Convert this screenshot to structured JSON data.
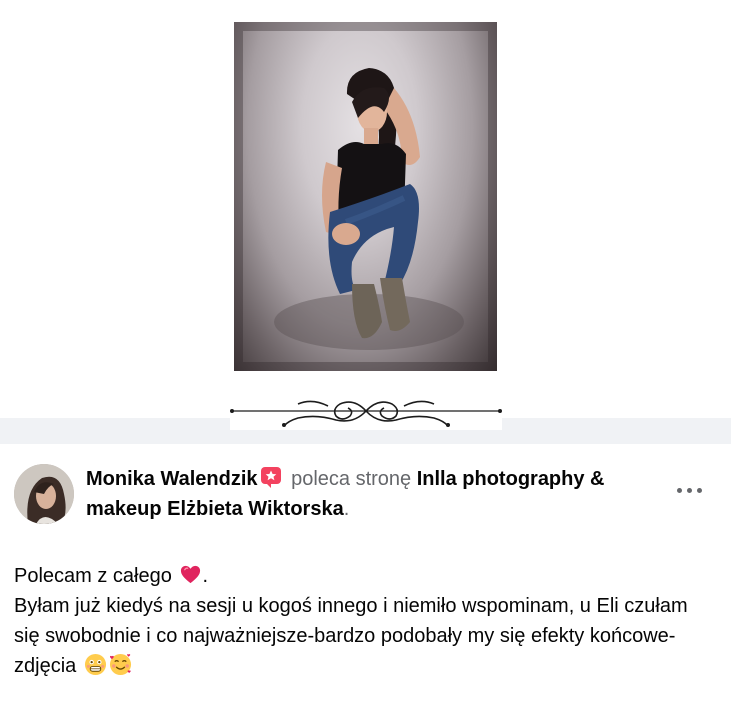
{
  "post": {
    "author": "Monika Walendzik",
    "verb": "poleca stronę",
    "page_name": "Inlla photography & makeup Elżbieta Wiktorska",
    "period": ".",
    "more_icon": "more-horizontal-icon",
    "badge_icon": "recommendation-star-icon",
    "body": {
      "line1": "Polecam z całego",
      "line1_end": ".",
      "line1_emoji": "heart-emoji",
      "line2": "Byłam już kiedyś na sesji u kogoś innego i niemiło wspominam, u Eli czułam się swobodnie i co najważniejsze-bardzo podobały my się efekty końcowe-zdjęcia",
      "end_emojis": [
        "flushed-grin-emoji",
        "smiling-face-with-hearts-emoji"
      ]
    }
  },
  "colors": {
    "text": "#050505",
    "secondary_text": "#65676b",
    "band": "#f0f2f5",
    "badge": "#f3425f",
    "heart": "#e0245e"
  }
}
